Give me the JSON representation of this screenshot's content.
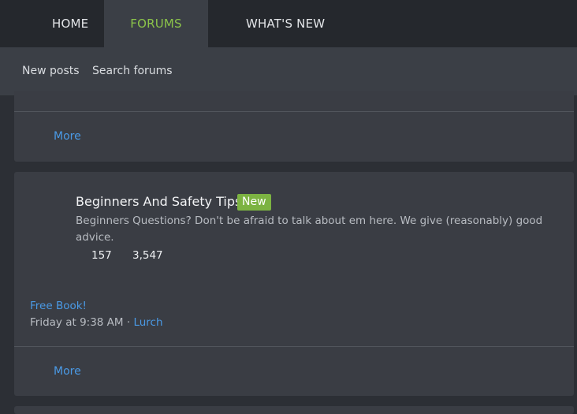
{
  "nav": {
    "tabs": [
      {
        "label": "HOME"
      },
      {
        "label": "FORUMS"
      },
      {
        "label": "WHAT'S NEW"
      }
    ]
  },
  "subnav": {
    "items": [
      {
        "label": "New posts"
      },
      {
        "label": "Search forums"
      }
    ]
  },
  "top_block": {
    "more_label": "More"
  },
  "forum": {
    "title": "Beginners And Safety Tips",
    "badge": "New",
    "description": "Beginners Questions? Don't be afraid to talk about em here. We give (reasonably) good advice.",
    "threads": "157",
    "messages": "3,547",
    "latest": {
      "title": "Free Book!",
      "time": "Friday at 9:38 AM",
      "separator": " · ",
      "user": "Lurch"
    },
    "more_label": "More"
  },
  "colors": {
    "accent_green": "#8bc34a",
    "link_blue": "#4a9ae6",
    "badge_green": "#7cb342"
  }
}
